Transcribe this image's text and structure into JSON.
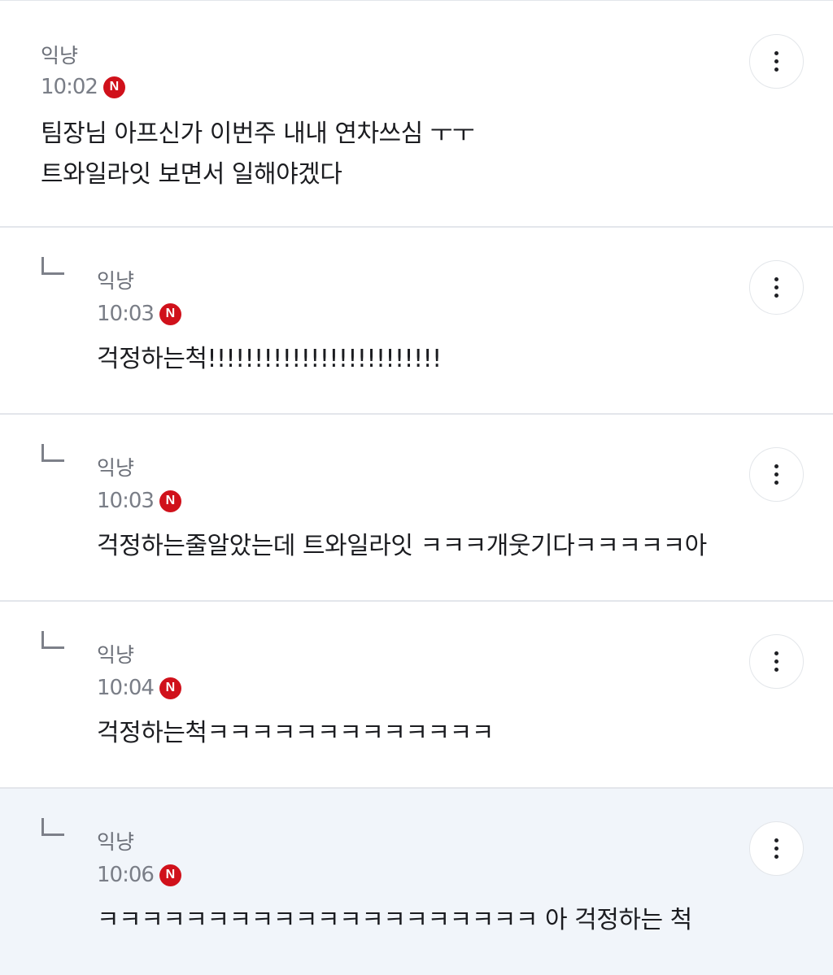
{
  "comments": [
    {
      "author": "익냥",
      "time": "10:02",
      "badge": "N",
      "text": "팀장님 아프신가 이번주 내내 연차쓰심 ㅜㅜ\n트와일라잇 보면서 일해야겠다"
    },
    {
      "author": "익냥",
      "time": "10:03",
      "badge": "N",
      "text": "걱정하는척!!!!!!!!!!!!!!!!!!!!!!!!!"
    },
    {
      "author": "익냥",
      "time": "10:03",
      "badge": "N",
      "text": "걱정하는줄알았는데 트와일라잇 ㅋㅋㅋ개웃기다ㅋㅋㅋㅋㅋ아"
    },
    {
      "author": "익냥",
      "time": "10:04",
      "badge": "N",
      "text": "걱정하는척ㅋㅋㅋㅋㅋㅋㅋㅋㅋㅋㅋㅋㅋ"
    },
    {
      "author": "익냥",
      "time": "10:06",
      "badge": "N",
      "text": "ㅋㅋㅋㅋㅋㅋㅋㅋㅋㅋㅋㅋㅋㅋㅋㅋㅋㅋㅋㅋ 아 걱정하는 척"
    }
  ],
  "icons": {
    "reply": "reply-arrow-icon",
    "more": "more-vertical-icon",
    "new": "new-badge-icon"
  },
  "colors": {
    "new_badge": "#d0111b",
    "highlight_background": "#f1f5fa",
    "meta_text": "#7a7e87",
    "body_text": "#1b1c20"
  }
}
